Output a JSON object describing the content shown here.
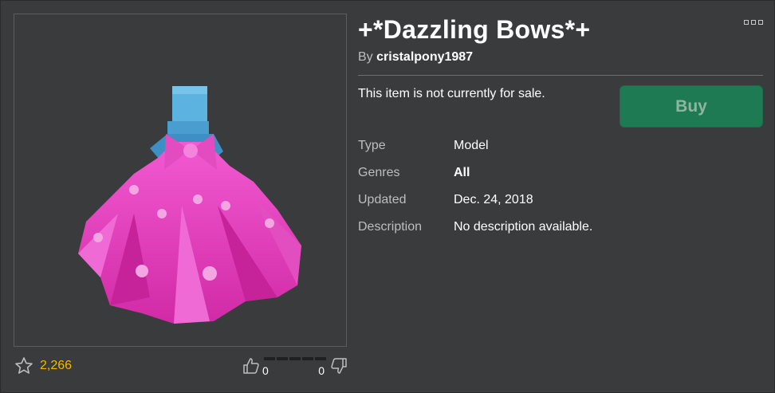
{
  "item": {
    "title": "+*Dazzling Bows*+",
    "by_prefix": "By",
    "creator": "cristalpony1987",
    "sale_status": "This item is not currently for sale.",
    "buy_label": "Buy"
  },
  "details": [
    {
      "label": "Type",
      "value": "Model"
    },
    {
      "label": "Genres",
      "value": "All"
    },
    {
      "label": "Updated",
      "value": "Dec. 24, 2018"
    },
    {
      "label": "Description",
      "value": "No description available."
    }
  ],
  "stats": {
    "favorites": "2,266",
    "upvotes": "0",
    "downvotes": "0"
  },
  "icons": [
    "star-icon",
    "thumbs-up-icon",
    "thumbs-down-icon",
    "more-options-icon"
  ],
  "colors": {
    "background": "#393b3d",
    "buy_button": "#1e7a52",
    "favorite_count": "#f6b702",
    "item_pink": "#e040b8",
    "avatar_blue": "#4fa8d8"
  }
}
